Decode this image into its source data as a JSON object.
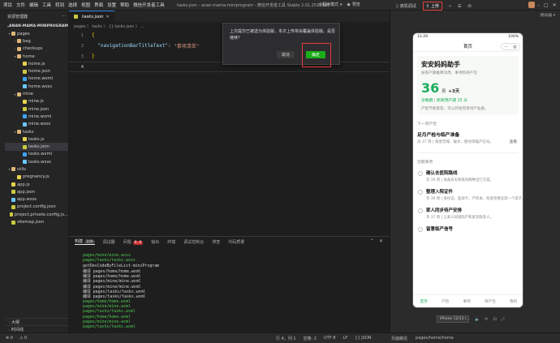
{
  "menu": [
    "项目",
    "文件",
    "编辑",
    "工具",
    "转到",
    "选择",
    "视图",
    "界面",
    "设置",
    "帮助",
    "微信开发者工具"
  ],
  "window_title": "tasks.json - anan-mama-miniprogram - 微信开发者工具 Stable 2.01.2510290",
  "toolbar": {
    "mode": "小程序模式",
    "preview": "预览",
    "real_debug": "真机调试",
    "clean_cache": "清缓存",
    "upload": "上传",
    "version": "版本管理",
    "details": "详情",
    "message": "消息"
  },
  "explorer": {
    "title": "资源管理器",
    "root": "ANAN-MAMA-MINIPROGRAM",
    "tree": [
      {
        "label": "pages",
        "type": "folder",
        "depth": 0,
        "open": true
      },
      {
        "label": "bag",
        "type": "folder",
        "depth": 1,
        "open": false
      },
      {
        "label": "checkups",
        "type": "folder",
        "depth": 1,
        "open": false
      },
      {
        "label": "home",
        "type": "folder",
        "depth": 1,
        "open": true
      },
      {
        "label": "home.js",
        "type": "js",
        "depth": 2
      },
      {
        "label": "home.json",
        "type": "json",
        "depth": 2
      },
      {
        "label": "home.wxml",
        "type": "wxml",
        "depth": 2
      },
      {
        "label": "home.wxss",
        "type": "wxss",
        "depth": 2
      },
      {
        "label": "mine",
        "type": "folder",
        "depth": 1,
        "open": true
      },
      {
        "label": "mine.js",
        "type": "js",
        "depth": 2
      },
      {
        "label": "mine.json",
        "type": "json",
        "depth": 2
      },
      {
        "label": "mine.wxml",
        "type": "wxml",
        "depth": 2
      },
      {
        "label": "mine.wxss",
        "type": "wxss",
        "depth": 2
      },
      {
        "label": "tasks",
        "type": "folder",
        "depth": 1,
        "open": true
      },
      {
        "label": "tasks.js",
        "type": "js",
        "depth": 2
      },
      {
        "label": "tasks.json",
        "type": "json",
        "depth": 2,
        "selected": true
      },
      {
        "label": "tasks.wxml",
        "type": "wxml",
        "depth": 2
      },
      {
        "label": "tasks.wxss",
        "type": "wxss",
        "depth": 2
      },
      {
        "label": "utils",
        "type": "folder",
        "depth": 0,
        "open": true
      },
      {
        "label": "pregnancy.js",
        "type": "js",
        "depth": 1
      },
      {
        "label": "app.js",
        "type": "js",
        "depth": 0
      },
      {
        "label": "app.json",
        "type": "json",
        "depth": 0
      },
      {
        "label": "app.wxss",
        "type": "wxss",
        "depth": 0
      },
      {
        "label": "project.config.json",
        "type": "json",
        "depth": 0
      },
      {
        "label": "project.private.config.js...",
        "type": "json",
        "depth": 0
      },
      {
        "label": "sitemap.json",
        "type": "json",
        "depth": 0
      }
    ],
    "outline": "大纲",
    "timeline": "时间线"
  },
  "editor": {
    "tab": "tasks.json",
    "breadcrumb": "pages 〉 tasks 〉 {} tasks.json 〉 ...",
    "lines": [
      {
        "n": "1",
        "parts": [
          {
            "c": "p",
            "t": "{"
          }
        ]
      },
      {
        "n": "2",
        "parts": [
          {
            "c": "w",
            "t": "  "
          },
          {
            "c": "k",
            "t": "\"navigationBarTitleText\""
          },
          {
            "c": "w",
            "t": ": "
          },
          {
            "c": "s",
            "t": "\"事项清单\""
          }
        ]
      },
      {
        "n": "3",
        "parts": [
          {
            "c": "p",
            "t": "}"
          }
        ]
      },
      {
        "n": "4",
        "parts": [],
        "current": true
      }
    ]
  },
  "modal": {
    "text": "上次提交已被选为体验版，本次上传将会覆盖体验版。是否继续?",
    "cancel": "取消",
    "ok": "确定"
  },
  "panel": {
    "tabs": [
      {
        "label": "构建",
        "badge": "100"
      },
      {
        "label": "调试器",
        "badge": ""
      },
      {
        "label": "问题",
        "badge": "9, 8",
        "red": true
      },
      {
        "label": "输出",
        "badge": ""
      },
      {
        "label": "终端",
        "badge": ""
      },
      {
        "label": "调试控制台",
        "badge": ""
      },
      {
        "label": "排查",
        "badge": ""
      },
      {
        "label": "代码质量",
        "badge": ""
      }
    ],
    "output": [
      {
        "t": "pages/mine/mine.wxss",
        "g": true
      },
      {
        "t": "pages/tasks/tasks.wxss",
        "g": true
      },
      {
        "t": "getDevCodeByFileList-miniProgram",
        "g": false
      },
      {
        "t": "编译  pages/home/home.wxml",
        "g": false
      },
      {
        "t": "编译  pages/home/home.wxml",
        "g": false
      },
      {
        "t": "编译  pages/mine/mine.wxml",
        "g": false
      },
      {
        "t": "编译  pages/mine/mine.wxml",
        "g": false
      },
      {
        "t": "编译  pages/tasks/tasks.wxml",
        "g": false
      },
      {
        "t": "编译  pages/tasks/tasks.wxml",
        "g": false
      },
      {
        "t": "pages/home/home.wxml",
        "g": true
      },
      {
        "t": "pages/mine/mine.wxml",
        "g": true
      },
      {
        "t": "pages/tasks/tasks.wxml",
        "g": true
      },
      {
        "t": "pages/home/home.wxml",
        "g": true
      },
      {
        "t": "pages/mine/mine.wxml",
        "g": true
      },
      {
        "t": "pages/tasks/tasks.wxml",
        "g": true
      }
    ]
  },
  "statusbar": {
    "left": [
      "⊗ 0",
      "⚠ 0"
    ],
    "right": [
      "行 4，列 1",
      "空格: 2",
      "UTF-8",
      "LF",
      "{} JSON"
    ],
    "page_path_label": "页面路径",
    "page_path": "pages/home/home"
  },
  "simulator": {
    "top_left": "",
    "top_right": "模拟器 ▾",
    "time": "12:29",
    "battery": "100%",
    "nav_title": "首页",
    "app_title": "安安妈妈助手",
    "app_sub": "按照产期推算孕周、事项和待产包",
    "week_num": "36",
    "week_unit": "周",
    "week_plus": "+3天",
    "tag_week": "孕晚期",
    "tag_due": "距离预产期 25 天",
    "note": "产检节奏变密，可以开始完善待产准备。",
    "next_label": "下一项产检",
    "next_title": "足月产检与临产准备",
    "next_desc": "孕 37 周 | 留意宫缩、破水、胎动等临产信号。",
    "next_view": "查看",
    "todo_label": "近期事项",
    "todos": [
      {
        "title": "确认去医院路线",
        "desc": "孕 36 周 | 准备白天和夜间两种出行方案。"
      },
      {
        "title": "整理入院证件",
        "desc": "孕 36 周 | 身份证、医保卡、产检本、检查单建议装一个袋子。"
      },
      {
        "title": "家人同步待产安排",
        "desc": "孕 37 周 | 让家人知道陪产和紧急联系人。"
      },
      {
        "title": "留意临产信号",
        "desc": ""
      }
    ],
    "tabbar": [
      "首页",
      "产检",
      "事项",
      "待产包",
      "我的"
    ],
    "device": "iPhone 12/13 (..."
  }
}
